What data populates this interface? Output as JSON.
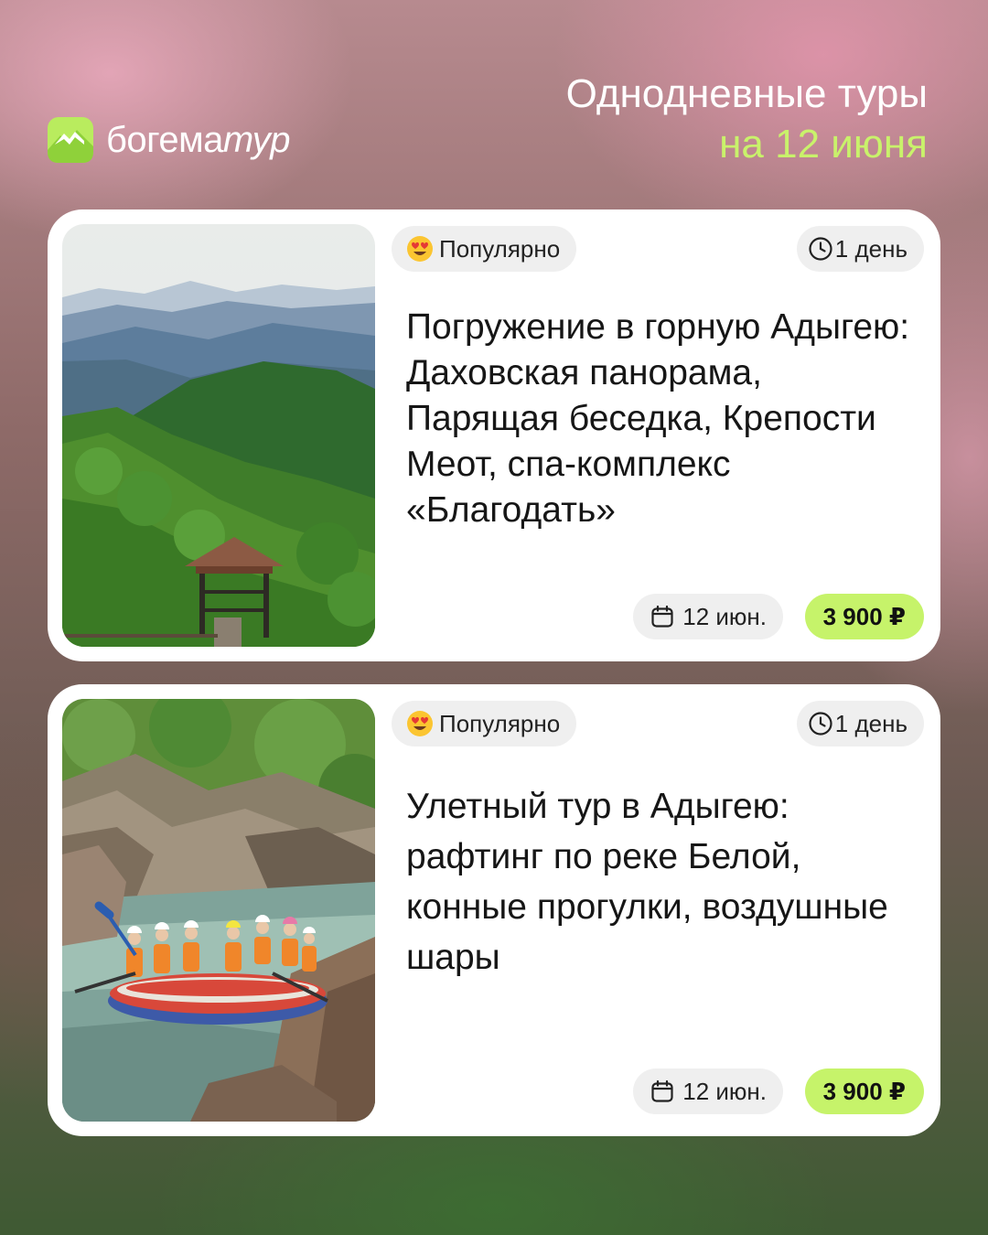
{
  "brand": {
    "name_main": "богема",
    "name_suffix": "тур",
    "accent_color": "#c6f36a",
    "logo_icon": "mountain-logo-icon"
  },
  "headline": {
    "line1": "Однодневные туры",
    "line2": "на 12 июня"
  },
  "tours": [
    {
      "badge": "Популярно",
      "badge_icon": "heart-eyes-emoji-icon",
      "duration": "1 день",
      "duration_icon": "clock-icon",
      "title": "Погружение в горную Адыгею: Даховская панорама, Парящая беседка, Крепости Меот, спа-комплекс «Благодать»",
      "date": "12 июн.",
      "date_icon": "calendar-icon",
      "price": "3 900 ₽",
      "photo": "mountain-panorama-gazebo-photo"
    },
    {
      "badge": "Популярно",
      "badge_icon": "heart-eyes-emoji-icon",
      "duration": "1 день",
      "duration_icon": "clock-icon",
      "title": "Улетный тур в Адыгею: рафтинг по реке Белой, конные прогулки, воздушные шары",
      "date": "12 июн.",
      "date_icon": "calendar-icon",
      "price": "3 900 ₽",
      "photo": "river-rafting-photo"
    }
  ]
}
